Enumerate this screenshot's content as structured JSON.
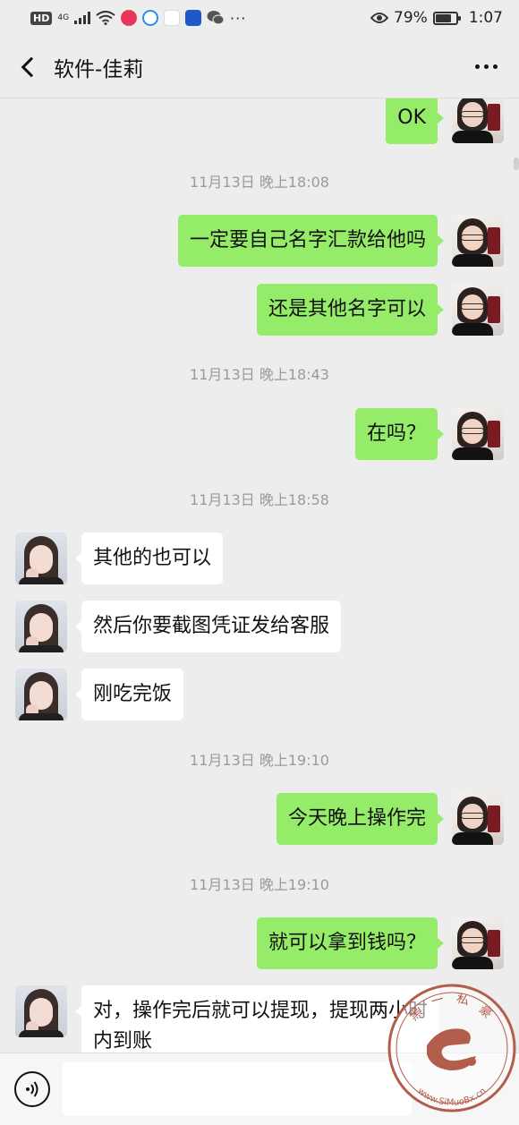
{
  "status_bar": {
    "hd": "HD",
    "network": "4G",
    "battery_percent": "79%",
    "battery_level": 0.79,
    "time": "1:07",
    "icons": [
      "hd-icon",
      "signal-icon",
      "wifi-icon",
      "app-icon-pink",
      "app-icon-blue",
      "weibo-icon",
      "app-icon-news",
      "wechat-icon",
      "more-icon",
      "eye-icon",
      "battery-icon"
    ]
  },
  "header": {
    "title": "软件-佳莉",
    "back_icon": "back-chevron-icon",
    "more_icon": "more-dots-icon"
  },
  "messages": [
    {
      "type": "sent",
      "text": "OK"
    },
    {
      "type": "time",
      "text": "11月13日 晚上18:08"
    },
    {
      "type": "sent",
      "text": "一定要自己名字汇款给他吗"
    },
    {
      "type": "sent",
      "text": "还是其他名字可以"
    },
    {
      "type": "time",
      "text": "11月13日 晚上18:43"
    },
    {
      "type": "sent",
      "text": "在吗？"
    },
    {
      "type": "time",
      "text": "11月13日 晚上18:58"
    },
    {
      "type": "received",
      "text": "其他的也可以"
    },
    {
      "type": "received",
      "text": "然后你要截图凭证发给客服"
    },
    {
      "type": "received",
      "text": "刚吃完饭"
    },
    {
      "type": "time",
      "text": "11月13日 晚上19:10"
    },
    {
      "type": "sent",
      "text": "今天晚上操作完"
    },
    {
      "type": "time",
      "text": "11月13日 晚上19:10"
    },
    {
      "type": "sent",
      "text": "就可以拿到钱吗？"
    },
    {
      "type": "received",
      "text": "对，操作完后就可以提现，提现两小时内到账"
    }
  ],
  "input_bar": {
    "voice_icon": "voice-icon",
    "input_value": ""
  },
  "watermark": {
    "top_text": "黑 一 私 豪",
    "bottom_text": "www.SiMuoBx.cn"
  }
}
